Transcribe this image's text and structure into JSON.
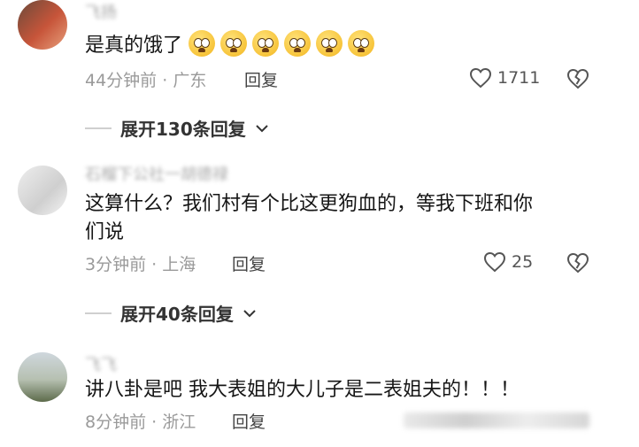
{
  "comments": [
    {
      "username": "飞扬",
      "text": "是真的饿了",
      "emoji_count": 6,
      "emoji_name": "pleading-face-icon",
      "time": "44分钟前",
      "location": "广东",
      "reply_label": "回复",
      "likes": "1711",
      "expand_label": "展开130条回复"
    },
    {
      "username": "石榴下公社一胡德禄",
      "text_line1": "这算什么？我们村有个比这更狗血的，等我下班和你",
      "text_line2": "们说",
      "time": "3分钟前",
      "location": "上海",
      "reply_label": "回复",
      "likes": "25",
      "expand_label": "展开40条回复"
    },
    {
      "username": "飞飞",
      "text": "讲八卦是吧 我大表姐的大儿子是二表姐夫的！！！",
      "time": "8分钟前",
      "location": "浙江",
      "reply_label": "回复"
    }
  ],
  "separator": "·",
  "colors": {
    "meta": "#9a9a9a",
    "text": "#161616",
    "divider": "#cfcfcf"
  }
}
